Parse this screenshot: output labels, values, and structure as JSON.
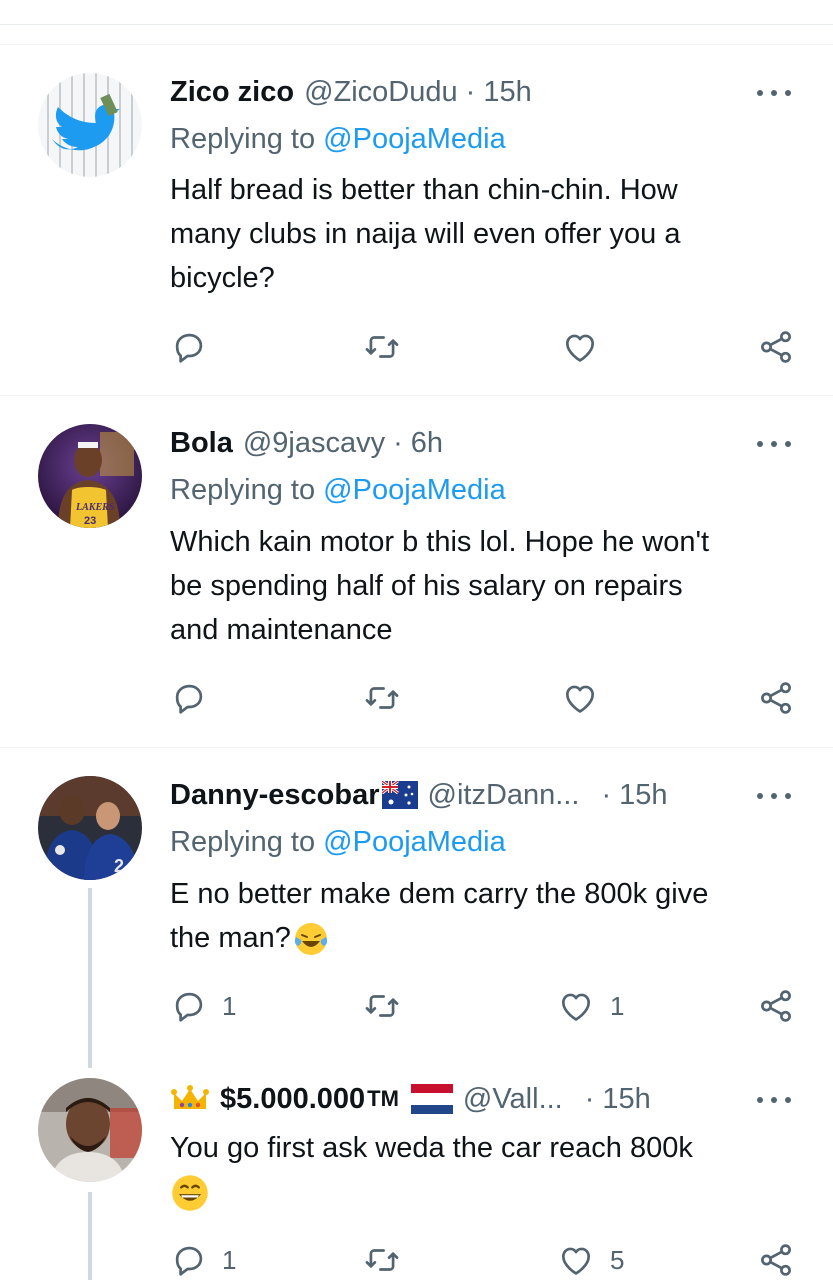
{
  "tweets": [
    {
      "name": "Zico zico",
      "handle": "@ZicoDudu",
      "time": "15h",
      "replying_prefix": "Replying to",
      "replying_to": "@PoojaMedia",
      "text_lines": [
        "Half bread is better than chin-chin. How",
        "many clubs in naija will even offer you a",
        "bicycle?"
      ],
      "reply_count": "",
      "like_count": ""
    },
    {
      "name": "Bola",
      "handle": "@9jascavy",
      "time": "6h",
      "replying_prefix": "Replying to",
      "replying_to": "@PoojaMedia",
      "text_lines": [
        "Which kain motor b this lol. Hope he won't",
        "be spending half of his salary on repairs",
        "and maintenance"
      ],
      "reply_count": "",
      "like_count": ""
    },
    {
      "name": "Danny-escobar",
      "handle": "@itzDann...",
      "time": "15h",
      "replying_prefix": "Replying to",
      "replying_to": "@PoojaMedia",
      "text_lines": [
        "E no better make dem carry the 800k give",
        "the man?"
      ],
      "reply_count": "1",
      "like_count": "1"
    },
    {
      "name": "$5.000.000",
      "name_suffix": "TM",
      "handle": "@Vall...",
      "time": "15h",
      "text_lines": [
        "You go first ask weda the car reach 800k"
      ],
      "reply_count": "1",
      "like_count": "5"
    }
  ],
  "separator": "·",
  "icons": [
    "reply-icon",
    "retweet-icon",
    "like-icon",
    "share-icon",
    "more-icon",
    "australia-flag-icon",
    "netherlands-flag-icon",
    "crown-emoji-icon",
    "laughing-tears-emoji-icon",
    "grinning-emoji-icon"
  ],
  "colors": {
    "link": "#1d9bf0",
    "secondary_text": "#536471",
    "primary_text": "#0f1419",
    "divider": "#eff3f4"
  }
}
